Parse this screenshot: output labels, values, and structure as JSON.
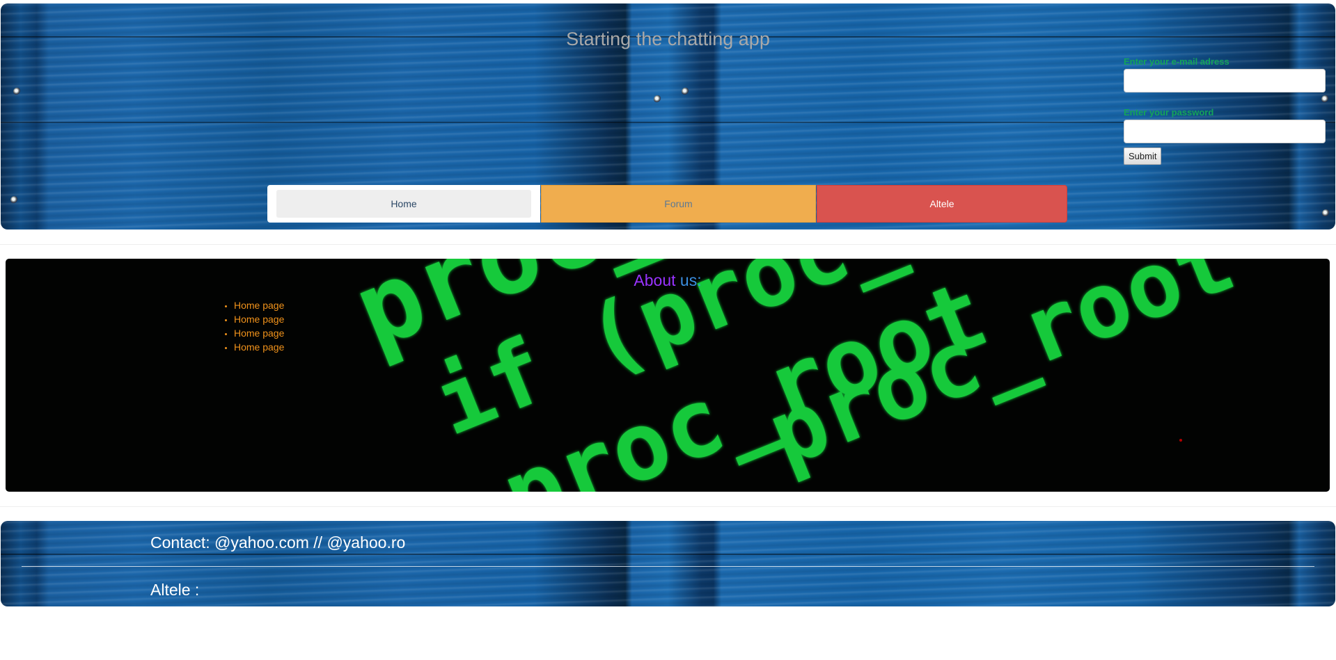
{
  "header": {
    "title": "Starting the chatting app",
    "login": {
      "email_label": "Enter your e-mail adress",
      "email_value": "",
      "password_label": "Enter your password",
      "password_value": "",
      "submit_label": "Submit"
    },
    "nav": [
      {
        "label": "Home",
        "color": "#eeeeee"
      },
      {
        "label": "Forum",
        "color": "#f0ad4e"
      },
      {
        "label": "Altele",
        "color": "#d9534f"
      }
    ]
  },
  "about": {
    "title_word1": "About",
    "title_word2": "us:",
    "items": [
      "Home page",
      "Home page",
      "Home page",
      "Home page"
    ],
    "background_code": [
      "proc_f",
      "if (proc_root = proc_",
      "proc_root == NUL",
      "proc_root"
    ]
  },
  "footer": {
    "contact": "Contact: @yahoo.com // @yahoo.ro",
    "altele": "Altele :"
  }
}
